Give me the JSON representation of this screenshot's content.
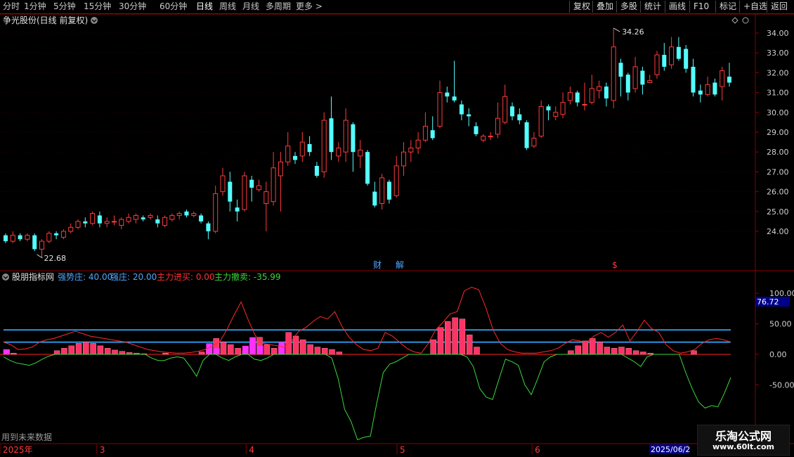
{
  "toolbar": {
    "timeframes": [
      "分时",
      "1分钟",
      "5分钟",
      "15分钟",
      "30分钟",
      "60分钟",
      "日线",
      "周线",
      "月线",
      "多周期",
      "更多 >"
    ],
    "active_timeframe": "日线",
    "tools": [
      "复权",
      "叠加",
      "多股",
      "统计",
      "画线",
      "F10",
      "标记",
      "+自选",
      "返回"
    ]
  },
  "main_panel": {
    "title": "争光股份(日线 前复权)",
    "high_label": "34.26",
    "low_label": "22.68",
    "markers": [
      "财",
      "解",
      "$"
    ]
  },
  "indicator_panel": {
    "name": "股朋指标网",
    "values": [
      {
        "label": "强势庄: 40.00",
        "color": "#4fa8ff"
      },
      {
        "label": "强庄: 20.00",
        "color": "#4fa8ff"
      },
      {
        "label": "主力进买: 0.00",
        "color": "#ff3030"
      },
      {
        "label": "主力撤卖: -35.99",
        "color": "#3ad83a"
      }
    ],
    "current_tag": "76.72",
    "note": "用到未来数据"
  },
  "date_axis": {
    "labels": [
      "2025年",
      "3",
      "4",
      "5",
      "6"
    ],
    "current": "2025/06/2"
  },
  "watermark": {
    "title": "乐淘公式网",
    "url": "www.60lt.com"
  },
  "colors": {
    "up": "#ff3b3b",
    "down": "#54ffff",
    "grid": "#8b0000",
    "line_blue": "#2ea8ff",
    "green": "#3ad83a",
    "magenta": "#ff30ff"
  },
  "chart_data": {
    "type": "candlestick",
    "price_axis": {
      "ticks": [
        "34.00",
        "33.00",
        "32.00",
        "31.00",
        "30.00",
        "29.00",
        "28.00",
        "27.00",
        "26.00",
        "25.00",
        "24.00"
      ],
      "range": [
        23.0,
        34.8
      ]
    },
    "indicator_axis": {
      "ticks": [
        "100.00",
        "50.00",
        "0.00",
        "-50.00"
      ],
      "range": [
        -140,
        115
      ],
      "hlines": [
        40,
        20,
        0
      ]
    },
    "candles": [
      [
        23.8,
        23.5,
        23.9,
        23.4
      ],
      [
        23.5,
        23.8,
        24.0,
        23.4
      ],
      [
        23.8,
        23.6,
        23.9,
        23.5
      ],
      [
        23.6,
        23.8,
        23.9,
        23.5
      ],
      [
        23.8,
        23.1,
        23.9,
        23.0
      ],
      [
        23.1,
        23.5,
        23.6,
        22.68
      ],
      [
        23.5,
        23.9,
        24.0,
        23.4
      ],
      [
        23.9,
        23.8,
        24.0,
        23.6
      ],
      [
        23.7,
        24.0,
        24.1,
        23.6
      ],
      [
        24.0,
        24.2,
        24.4,
        23.9
      ],
      [
        24.2,
        24.5,
        24.6,
        24.1
      ],
      [
        24.5,
        24.4,
        24.7,
        24.2
      ],
      [
        24.4,
        24.9,
        25.0,
        24.3
      ],
      [
        24.8,
        24.4,
        25.0,
        24.2
      ],
      [
        24.4,
        24.5,
        24.7,
        24.2
      ],
      [
        24.5,
        24.5,
        24.8,
        24.3
      ],
      [
        24.3,
        24.6,
        24.7,
        24.1
      ],
      [
        24.5,
        24.7,
        24.9,
        24.4
      ],
      [
        24.6,
        24.8,
        24.9,
        24.4
      ],
      [
        24.7,
        24.6,
        24.8,
        24.5
      ],
      [
        24.7,
        24.8,
        24.9,
        24.6
      ],
      [
        24.6,
        24.4,
        24.8,
        24.2
      ],
      [
        24.3,
        24.7,
        24.8,
        24.2
      ],
      [
        24.6,
        24.8,
        24.9,
        24.5
      ],
      [
        24.8,
        24.9,
        25.0,
        24.6
      ],
      [
        25.0,
        24.8,
        25.1,
        24.7
      ],
      [
        24.8,
        24.9,
        25.0,
        24.7
      ],
      [
        24.8,
        24.5,
        24.9,
        24.4
      ],
      [
        24.4,
        24.0,
        24.5,
        23.6
      ],
      [
        24.0,
        25.9,
        26.3,
        23.9
      ],
      [
        26.0,
        26.8,
        27.2,
        25.8
      ],
      [
        26.5,
        25.5,
        27.0,
        25.0
      ],
      [
        25.2,
        25.0,
        25.6,
        24.5
      ],
      [
        25.1,
        26.8,
        27.0,
        25.0
      ],
      [
        26.6,
        26.2,
        26.8,
        25.5
      ],
      [
        26.1,
        26.3,
        26.6,
        26.0
      ],
      [
        25.4,
        26.0,
        26.5,
        24.0
      ],
      [
        25.5,
        27.2,
        28.0,
        25.3
      ],
      [
        26.8,
        27.5,
        28.0,
        25.0
      ],
      [
        27.5,
        28.3,
        29.0,
        27.3
      ],
      [
        27.8,
        27.6,
        28.0,
        27.4
      ],
      [
        27.8,
        28.5,
        29.0,
        27.5
      ],
      [
        28.4,
        28.0,
        28.8,
        27.8
      ],
      [
        27.3,
        26.8,
        27.5,
        26.7
      ],
      [
        27.0,
        29.6,
        30.0,
        26.7
      ],
      [
        29.7,
        28.0,
        30.8,
        27.6
      ],
      [
        27.8,
        28.2,
        28.5,
        27.5
      ],
      [
        28.0,
        29.6,
        30.2,
        27.5
      ],
      [
        29.4,
        28.0,
        29.5,
        27.0
      ],
      [
        27.8,
        28.1,
        28.6,
        27.2
      ],
      [
        28.0,
        26.4,
        28.1,
        26.3
      ],
      [
        26.0,
        25.3,
        26.5,
        25.2
      ],
      [
        25.4,
        26.7,
        26.9,
        25.1
      ],
      [
        26.5,
        25.6,
        26.6,
        25.4
      ],
      [
        25.8,
        27.3,
        27.8,
        25.7
      ],
      [
        27.3,
        28.0,
        28.5,
        26.8
      ],
      [
        28.0,
        28.2,
        28.6,
        27.5
      ],
      [
        28.2,
        28.6,
        29.0,
        27.9
      ],
      [
        28.6,
        29.3,
        30.0,
        28.5
      ],
      [
        29.1,
        28.7,
        29.8,
        28.6
      ],
      [
        29.3,
        31.0,
        31.6,
        29.2
      ],
      [
        31.0,
        30.8,
        31.3,
        30.5
      ],
      [
        30.8,
        30.6,
        32.6,
        30.5
      ],
      [
        30.4,
        29.9,
        30.6,
        29.6
      ],
      [
        29.9,
        29.8,
        30.2,
        29.3
      ],
      [
        29.3,
        28.9,
        29.5,
        28.8
      ],
      [
        28.6,
        28.8,
        28.9,
        28.5
      ],
      [
        28.8,
        28.8,
        29.0,
        28.6
      ],
      [
        28.9,
        29.7,
        30.5,
        28.7
      ],
      [
        29.5,
        30.8,
        31.4,
        29.4
      ],
      [
        30.3,
        29.8,
        30.5,
        29.6
      ],
      [
        29.9,
        29.6,
        30.2,
        29.4
      ],
      [
        29.5,
        28.2,
        29.6,
        28.1
      ],
      [
        28.3,
        28.7,
        29.0,
        28.2
      ],
      [
        28.8,
        30.3,
        30.6,
        28.7
      ],
      [
        30.3,
        30.1,
        30.4,
        29.6
      ],
      [
        29.8,
        30.0,
        30.3,
        29.6
      ],
      [
        29.9,
        30.5,
        31.0,
        29.7
      ],
      [
        30.6,
        31.0,
        31.3,
        30.4
      ],
      [
        31.0,
        30.5,
        31.1,
        30.3
      ],
      [
        30.4,
        30.4,
        31.5,
        30.1
      ],
      [
        30.5,
        31.2,
        31.9,
        30.4
      ],
      [
        31.1,
        31.3,
        31.6,
        30.7
      ],
      [
        31.3,
        30.7,
        31.5,
        30.3
      ],
      [
        30.6,
        33.3,
        34.26,
        30.2
      ],
      [
        32.5,
        31.8,
        32.7,
        30.8
      ],
      [
        31.9,
        31.0,
        32.0,
        30.6
      ],
      [
        31.2,
        32.3,
        32.8,
        31.0
      ],
      [
        32.1,
        31.4,
        32.3,
        30.9
      ],
      [
        31.5,
        31.6,
        31.9,
        31.5
      ],
      [
        31.9,
        32.9,
        33.1,
        31.7
      ],
      [
        32.9,
        32.3,
        33.5,
        32.1
      ],
      [
        32.4,
        33.3,
        33.8,
        32.2
      ],
      [
        33.3,
        32.7,
        33.8,
        32.6
      ],
      [
        33.2,
        32.2,
        33.4,
        32.0
      ],
      [
        32.3,
        31.0,
        32.7,
        30.8
      ],
      [
        31.1,
        30.9,
        31.4,
        30.5
      ],
      [
        30.9,
        31.4,
        31.8,
        30.8
      ],
      [
        31.5,
        30.9,
        31.7,
        30.8
      ],
      [
        31.3,
        32.1,
        32.3,
        30.6
      ],
      [
        31.8,
        31.5,
        32.5,
        31.3
      ]
    ],
    "attack_line": [
      20,
      16,
      8,
      9,
      12,
      20,
      24,
      26,
      30,
      34,
      38,
      34,
      30,
      28,
      26,
      24,
      22,
      20,
      16,
      12,
      8,
      6,
      4,
      3,
      2,
      2,
      3,
      5,
      8,
      14,
      20,
      40,
      64,
      86,
      56,
      30,
      18,
      16,
      14,
      12,
      22,
      38,
      44,
      54,
      62,
      58,
      70,
      46,
      28,
      16,
      8,
      6,
      10,
      36,
      30,
      20,
      10,
      4,
      2,
      18,
      40,
      52,
      66,
      70,
      104,
      110,
      106,
      76,
      40,
      18,
      8,
      4,
      2,
      2,
      2,
      4,
      6,
      10,
      18,
      24,
      22,
      20,
      30,
      36,
      28,
      36,
      48,
      22,
      38,
      56,
      42,
      36,
      16,
      6,
      2,
      4,
      8,
      18,
      24,
      26,
      24,
      20
    ],
    "volume_bars": [
      8,
      2,
      0,
      0,
      0,
      0,
      0,
      6,
      10,
      14,
      18,
      20,
      18,
      14,
      10,
      7,
      5,
      3,
      2,
      1,
      0,
      0,
      2,
      0,
      0,
      0,
      0,
      4,
      8,
      26,
      20,
      16,
      10,
      6,
      18,
      28,
      16,
      10,
      14,
      36,
      30,
      24,
      16,
      12,
      10,
      8,
      4,
      0,
      0,
      0,
      0,
      0,
      0,
      0,
      0,
      0,
      0,
      0,
      0,
      24,
      44,
      54,
      60,
      58,
      32,
      12,
      0,
      0,
      0,
      0,
      0,
      0,
      0,
      0,
      0,
      0,
      0,
      0,
      6,
      14,
      22,
      26,
      20,
      12,
      10,
      12,
      10,
      6,
      4,
      2,
      0,
      0,
      0,
      0,
      0,
      6,
      0,
      0,
      0,
      0,
      0
    ],
    "magenta_bars": [
      8,
      0,
      0,
      0,
      0,
      0,
      0,
      0,
      0,
      0,
      0,
      0,
      0,
      0,
      0,
      0,
      0,
      0,
      0,
      0,
      0,
      0,
      0,
      0,
      0,
      0,
      0,
      0,
      18,
      10,
      0,
      0,
      0,
      14,
      28,
      14,
      0,
      0,
      20,
      0,
      0,
      0,
      0,
      0,
      0,
      0,
      0,
      0,
      0,
      0,
      0,
      0,
      0,
      0,
      0,
      0,
      0,
      0,
      0,
      0,
      0,
      0,
      0,
      0,
      0,
      0,
      0,
      0,
      0,
      0,
      0,
      0,
      0,
      0,
      0,
      0,
      0,
      0,
      0,
      0,
      0,
      0,
      0,
      0,
      0,
      0,
      0,
      0,
      0,
      0,
      0,
      0,
      0,
      0,
      0,
      0,
      0,
      0,
      0,
      0,
      0
    ],
    "retreat_line": [
      -4,
      -10,
      -14,
      -16,
      -18,
      -14,
      -8,
      -3,
      0,
      0,
      0,
      0,
      0,
      0,
      0,
      0,
      0,
      0,
      0,
      0,
      0,
      0,
      0,
      -6,
      -10,
      -10,
      -6,
      -4,
      -6,
      -20,
      -36,
      -10,
      0,
      0,
      -6,
      -10,
      -4,
      0,
      0,
      -8,
      -10,
      -6,
      0,
      0,
      0,
      0,
      0,
      0,
      0,
      0,
      0,
      -6,
      -40,
      -90,
      -110,
      -140,
      -136,
      -134,
      -80,
      -30,
      -16,
      -12,
      -6,
      0,
      0,
      0,
      0,
      0,
      0,
      0,
      0,
      0,
      -4,
      -20,
      -56,
      -70,
      -74,
      -40,
      -8,
      -12,
      -18,
      -50,
      -66,
      -40,
      -12,
      -4,
      0,
      0,
      0,
      0,
      0,
      0,
      0,
      0,
      0,
      0,
      0,
      -6,
      -12,
      -20,
      -4,
      0,
      0,
      0,
      0,
      0,
      -30,
      -56,
      -78,
      -88,
      -84,
      -86,
      -64,
      -38
    ],
    "date_positions": [
      0,
      0.122,
      0.31,
      0.5,
      0.67
    ]
  }
}
